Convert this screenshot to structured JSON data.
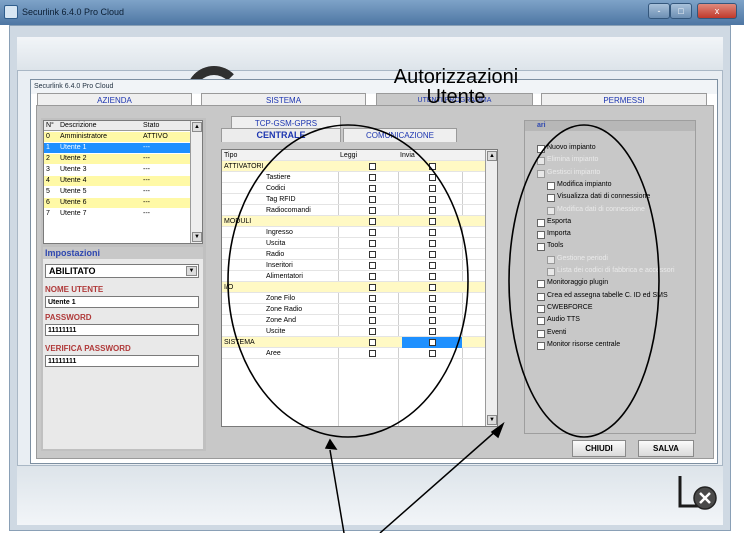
{
  "outer_window": {
    "title": "Securlink 6.4.0 Pro Cloud",
    "min": "-",
    "max": "□",
    "close": "x"
  },
  "dialog": {
    "title": "Securlink 6.4.0 Pro Cloud"
  },
  "tabs": {
    "azienda": "AZIENDA",
    "sistema": "SISTEMA",
    "utenti": "UTENTI PROGRAMMA",
    "permessi": "PERMESSI"
  },
  "subtabs": {
    "tcp": "TCP-GSM-GPRS",
    "centrale": "CENTRALE",
    "comunicazione": "COMUNICAZIONE"
  },
  "users_table": {
    "headers": [
      "N°",
      "Descrizione",
      "Stato"
    ],
    "rows": [
      [
        "0",
        "Amministratore",
        "ATTIVO"
      ],
      [
        "1",
        "Utente 1",
        "---"
      ],
      [
        "2",
        "Utente 2",
        "---"
      ],
      [
        "3",
        "Utente 3",
        "---"
      ],
      [
        "4",
        "Utente 4",
        "---"
      ],
      [
        "5",
        "Utente 5",
        "---"
      ],
      [
        "6",
        "Utente 6",
        "---"
      ],
      [
        "7",
        "Utente 7",
        "---"
      ]
    ]
  },
  "impostazioni": {
    "title": "Impostazioni",
    "status_value": "ABILITATO",
    "nome_label": "NOME UTENTE",
    "nome_value": "Utente 1",
    "password_label": "PASSWORD",
    "password_value": "11111111",
    "verifica_label": "VERIFICA PASSWORD",
    "verifica_value": "11111111"
  },
  "grid": {
    "headers": [
      "Tipo",
      "Leggi",
      "Invia"
    ],
    "rows": [
      {
        "name": "ATTIVATORI",
        "section": true
      },
      {
        "name": "Tastiere",
        "section": false
      },
      {
        "name": "Codici",
        "section": false
      },
      {
        "name": "Tag RFID",
        "section": false
      },
      {
        "name": "Radiocomandi",
        "section": false
      },
      {
        "name": "MODULI",
        "section": true
      },
      {
        "name": "Ingresso",
        "section": false
      },
      {
        "name": "Uscita",
        "section": false
      },
      {
        "name": "Radio",
        "section": false
      },
      {
        "name": "Inseritori",
        "section": false
      },
      {
        "name": "Alimentatori",
        "section": false
      },
      {
        "name": "I/O",
        "section": true
      },
      {
        "name": "Zone Filo",
        "section": false
      },
      {
        "name": "Zone Radio",
        "section": false
      },
      {
        "name": "Zone And",
        "section": false
      },
      {
        "name": "Uscite",
        "section": false
      },
      {
        "name": "SISTEMA",
        "section": true
      },
      {
        "name": "Aree",
        "section": false
      }
    ]
  },
  "permessi": {
    "header": "ari",
    "items": [
      {
        "label": "Nuovo impianto",
        "disabled": false,
        "indent": false
      },
      {
        "label": "Elimina impianto",
        "disabled": true,
        "indent": false
      },
      {
        "label": "Gestisci impianto",
        "disabled": true,
        "indent": false
      },
      {
        "label": "Modifica impianto",
        "disabled": false,
        "indent": true
      },
      {
        "label": "Visualizza dati di connessione",
        "disabled": false,
        "indent": true
      },
      {
        "label": "Modifica dati di connessione",
        "disabled": true,
        "indent": true
      },
      {
        "label": "Esporta",
        "disabled": false,
        "indent": false
      },
      {
        "label": "Importa",
        "disabled": false,
        "indent": false
      },
      {
        "label": "Tools",
        "disabled": false,
        "indent": false
      },
      {
        "label": "Gestione periodi",
        "disabled": true,
        "indent": true
      },
      {
        "label": "Lista dei codici di fabbrica e accessori",
        "disabled": true,
        "indent": true
      },
      {
        "label": "Monitoraggio plugin",
        "disabled": false,
        "indent": false
      },
      {
        "label": "Crea ed assegna tabelle C. ID ed SMS",
        "disabled": false,
        "indent": false
      },
      {
        "label": "CWEBFORCE",
        "disabled": false,
        "indent": false
      },
      {
        "label": "Audio TTS",
        "disabled": false,
        "indent": false
      },
      {
        "label": "Eventi",
        "disabled": false,
        "indent": false
      },
      {
        "label": "Monitor risorse centrale",
        "disabled": false,
        "indent": false
      }
    ]
  },
  "buttons": {
    "chiudi": "CHIUDI",
    "salva": "SALVA"
  },
  "annotation": {
    "line1": "Autorizzazioni",
    "line2": "Utente"
  }
}
